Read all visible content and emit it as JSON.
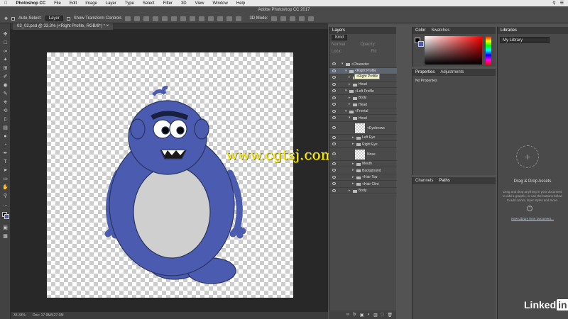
{
  "menubar": {
    "apple": "",
    "app": "Photoshop CC",
    "items": [
      "File",
      "Edit",
      "Image",
      "Layer",
      "Type",
      "Select",
      "Filter",
      "3D",
      "View",
      "Window",
      "Help"
    ]
  },
  "window_title": "Adobe Photoshop CC 2017",
  "options": {
    "auto_select": "Auto-Select:",
    "auto_select_value": "Layer",
    "show_transform": "Show Transform Controls",
    "mode_3d": "3D Mode:"
  },
  "document": {
    "tab": "03_02.psd @ 33.3% (<Right Profile, RGB/8*) *"
  },
  "status": {
    "zoom": "33.33%",
    "doc": "Doc: 17.9M/427.0M"
  },
  "layers_panel": {
    "tabs": [
      "Layers"
    ],
    "kind": "Kind",
    "normal": "Normal",
    "opacity": "Opacity:",
    "lock": "Lock:",
    "fill": "Fill:",
    "layers": [
      {
        "name": "<Character",
        "indent": 1,
        "type": "group",
        "open": true
      },
      {
        "name": "<Right Profile",
        "indent": 2,
        "type": "group",
        "open": true
      },
      {
        "name": "Body",
        "indent": 3,
        "type": "group",
        "open": false
      },
      {
        "name": "Head",
        "indent": 3,
        "type": "group",
        "open": false
      },
      {
        "name": "<Left Profile",
        "indent": 2,
        "type": "group",
        "open": true
      },
      {
        "name": "Body",
        "indent": 3,
        "type": "group",
        "open": false
      },
      {
        "name": "Head",
        "indent": 3,
        "type": "group",
        "open": false
      },
      {
        "name": "<Frontal",
        "indent": 2,
        "type": "group",
        "open": true
      },
      {
        "name": "Head",
        "indent": 3,
        "type": "group",
        "open": true
      },
      {
        "name": "<Eyebrows",
        "indent": 4,
        "type": "layer"
      },
      {
        "name": "Left Eye",
        "indent": 4,
        "type": "group",
        "open": false
      },
      {
        "name": "Right Eye",
        "indent": 4,
        "type": "group",
        "open": false
      },
      {
        "name": "Nose",
        "indent": 4,
        "type": "layer"
      },
      {
        "name": "Mouth",
        "indent": 4,
        "type": "group",
        "open": false
      },
      {
        "name": "Background",
        "indent": 4,
        "type": "group",
        "open": false
      },
      {
        "name": "<Hair Top",
        "indent": 4,
        "type": "group",
        "open": false
      },
      {
        "name": "<Hair Clint",
        "indent": 4,
        "type": "group",
        "open": false
      },
      {
        "name": "Body",
        "indent": 3,
        "type": "group",
        "open": false
      }
    ],
    "tooltip": "<Right Profile"
  },
  "color_panel": {
    "tabs": [
      "Color",
      "Swatches"
    ],
    "fg": "#000000",
    "bg": "#4a5bb0"
  },
  "properties_panel": {
    "tabs": [
      "Properties",
      "Adjustments"
    ],
    "empty": "No Properties"
  },
  "channels_panel": {
    "tabs": [
      "Channels",
      "Paths"
    ]
  },
  "library_panel": {
    "tabs": [
      "Libraries"
    ],
    "selected": "My Library",
    "title": "Drag & Drop Assets",
    "desc": "Drag and drop anything in your document to add a graphic, or use the buttons below to add colors, layer styles and more.",
    "link": "New Library from Document..."
  },
  "brand": {
    "text": "Linked",
    "badge": "in"
  },
  "watermark": "www.cgtsj.com",
  "colors": {
    "monster_blue": "#4a5bb0",
    "belly": "#cfcfcf",
    "outline": "#2a3560"
  }
}
